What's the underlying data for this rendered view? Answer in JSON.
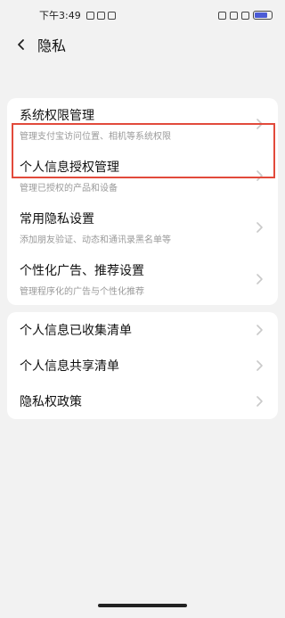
{
  "status": {
    "time": "下午3:49",
    "battery_level": 0.7
  },
  "header": {
    "title": "隐私"
  },
  "groups": [
    {
      "items": [
        {
          "label": "系统权限管理",
          "sub": "管理支付宝访问位置、相机等系统权限"
        },
        {
          "label": "个人信息授权管理",
          "sub": "管理已授权的产品和设备"
        },
        {
          "label": "常用隐私设置",
          "sub": "添加朋友验证、动态和通讯录黑名单等"
        },
        {
          "label": "个性化广告、推荐设置",
          "sub": "管理程序化的广告与个性化推荐"
        }
      ]
    },
    {
      "items": [
        {
          "label": "个人信息已收集清单"
        },
        {
          "label": "个人信息共享清单"
        },
        {
          "label": "隐私权政策"
        }
      ]
    }
  ],
  "colors": {
    "highlight": "#e24a3b",
    "background": "#f2f2f2"
  }
}
